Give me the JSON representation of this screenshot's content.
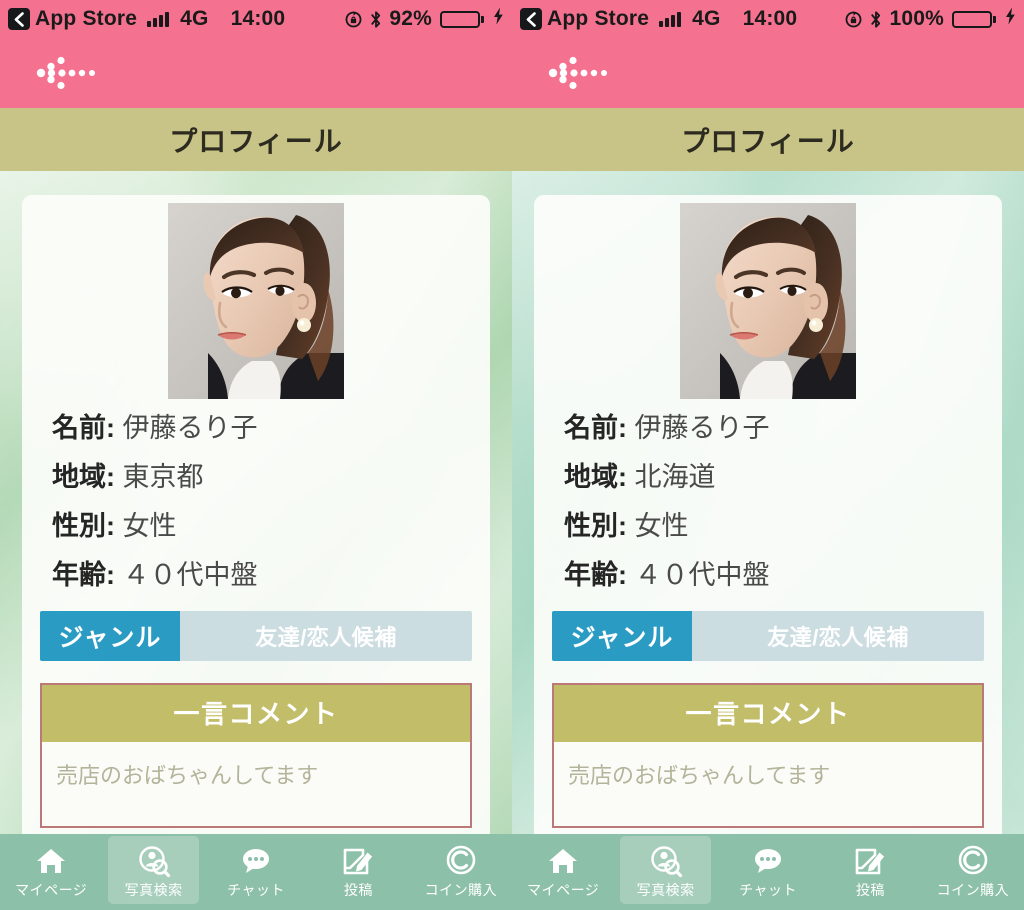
{
  "panels": [
    {
      "status_bar": {
        "back_icon": "chevron-left-icon",
        "carrier_label": "App Store",
        "signal_icon": "signal-bars-icon",
        "network": "4G",
        "time": "14:00",
        "rotation_lock_icon": "rotation-lock-icon",
        "bluetooth_icon": "bluetooth-icon",
        "battery_percent": "92%",
        "battery_level": 92,
        "charging_icon": "lightning-bolt-icon"
      },
      "nav": {
        "back_icon": "dotted-arrow-left-icon"
      },
      "title": "プロフィール",
      "photo_alt": "profile-photo",
      "fields": [
        {
          "label": "名前:",
          "value": "伊藤るり子"
        },
        {
          "label": "地域:",
          "value": "東京都"
        },
        {
          "label": "性別:",
          "value": "女性"
        },
        {
          "label": "年齢:",
          "value": "４０代中盤"
        }
      ],
      "genre": {
        "label": "ジャンル",
        "value": "友達/恋人候補"
      },
      "comment": {
        "header": "一言コメント",
        "text": "売店のおばちゃんしてます"
      },
      "tabs": [
        {
          "label": "マイページ",
          "icon": "home-icon",
          "active": false
        },
        {
          "label": "写真検索",
          "icon": "person-search-icon",
          "active": true
        },
        {
          "label": "チャット",
          "icon": "chat-bubble-icon",
          "active": false
        },
        {
          "label": "投稿",
          "icon": "compose-pencil-icon",
          "active": false
        },
        {
          "label": "コイン購入",
          "icon": "coin-c-icon",
          "active": false
        }
      ]
    },
    {
      "status_bar": {
        "back_icon": "chevron-left-icon",
        "carrier_label": "App Store",
        "signal_icon": "signal-bars-icon",
        "network": "4G",
        "time": "14:00",
        "rotation_lock_icon": "rotation-lock-icon",
        "bluetooth_icon": "bluetooth-icon",
        "battery_percent": "100%",
        "battery_level": 100,
        "charging_icon": "lightning-bolt-icon"
      },
      "nav": {
        "back_icon": "dotted-arrow-left-icon"
      },
      "title": "プロフィール",
      "photo_alt": "profile-photo",
      "fields": [
        {
          "label": "名前:",
          "value": "伊藤るり子"
        },
        {
          "label": "地域:",
          "value": "北海道"
        },
        {
          "label": "性別:",
          "value": "女性"
        },
        {
          "label": "年齢:",
          "value": "４０代中盤"
        }
      ],
      "genre": {
        "label": "ジャンル",
        "value": "友達/恋人候補"
      },
      "comment": {
        "header": "一言コメント",
        "text": "売店のおばちゃんしてます"
      },
      "tabs": [
        {
          "label": "マイページ",
          "icon": "home-icon",
          "active": false
        },
        {
          "label": "写真検索",
          "icon": "person-search-icon",
          "active": true
        },
        {
          "label": "チャット",
          "icon": "chat-bubble-icon",
          "active": false
        },
        {
          "label": "投稿",
          "icon": "compose-pencil-icon",
          "active": false
        },
        {
          "label": "コイン購入",
          "icon": "coin-c-icon",
          "active": false
        }
      ]
    }
  ],
  "colors": {
    "status_nav_pink": "#f4718f",
    "title_khaki": "#c8c488",
    "genre_accent_teal": "#2a9cc3",
    "genre_value_bg": "#ccdde2",
    "comment_header_olive": "#c2bd68",
    "comment_border_red": "#bb7a78",
    "tabbar_green": "#8dc0a8",
    "battery_green": "#5ddc7b"
  }
}
